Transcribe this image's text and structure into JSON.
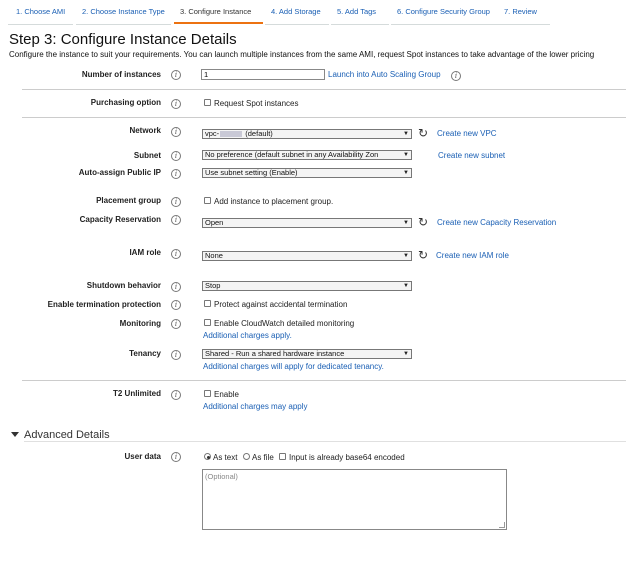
{
  "tabs": [
    {
      "label": "1. Choose AMI"
    },
    {
      "label": "2. Choose Instance Type"
    },
    {
      "label": "3. Configure Instance"
    },
    {
      "label": "4. Add Storage"
    },
    {
      "label": "5. Add Tags"
    },
    {
      "label": "6. Configure Security Group"
    },
    {
      "label": "7. Review"
    }
  ],
  "active_tab": "3. Configure Instance",
  "header": {
    "title": "Step 3: Configure Instance Details",
    "subtitle": "Configure the instance to suit your requirements. You can launch multiple instances from the same AMI, request Spot instances to take advantage of the lower pricing"
  },
  "info_glyph": "i",
  "rows": {
    "instances": {
      "label": "Number of instances",
      "value": "1",
      "link": "Launch into Auto Scaling Group"
    },
    "purchasing": {
      "label": "Purchasing option",
      "checkbox": "Request Spot instances"
    },
    "network": {
      "label": "Network",
      "value_prefix": "vpc-",
      "value_suffix": "(default)",
      "link": "Create new VPC"
    },
    "subnet": {
      "label": "Subnet",
      "value": "No preference (default subnet in any Availability Zon",
      "link": "Create new subnet"
    },
    "public_ip": {
      "label": "Auto-assign Public IP",
      "value": "Use subnet setting (Enable)"
    },
    "placement": {
      "label": "Placement group",
      "checkbox": "Add instance to placement group."
    },
    "capacity": {
      "label": "Capacity Reservation",
      "value": "Open",
      "link": "Create new Capacity Reservation"
    },
    "iam": {
      "label": "IAM role",
      "value": "None",
      "link": "Create new IAM role"
    },
    "shutdown": {
      "label": "Shutdown behavior",
      "value": "Stop"
    },
    "termination": {
      "label": "Enable termination protection",
      "checkbox": "Protect against accidental termination"
    },
    "monitoring": {
      "label": "Monitoring",
      "checkbox": "Enable CloudWatch detailed monitoring",
      "note": "Additional charges apply."
    },
    "tenancy": {
      "label": "Tenancy",
      "value": "Shared - Run a shared hardware instance",
      "note": "Additional charges will apply for dedicated tenancy."
    },
    "t2": {
      "label": "T2 Unlimited",
      "checkbox": "Enable",
      "note": "Additional charges may apply"
    }
  },
  "advanced": {
    "title": "Advanced Details",
    "user_data": {
      "label": "User data",
      "radio_text": "As text",
      "radio_file": "As file",
      "checkbox": "Input is already base64 encoded",
      "placeholder": "(Optional)"
    }
  },
  "colors": {
    "link": "#1a5fb4",
    "active_tab_underline": "#ec7211"
  },
  "icons": {
    "info": "info-icon",
    "refresh": "refresh-icon",
    "dropdown": "chevron-down-icon",
    "collapse": "caret-down-icon"
  }
}
